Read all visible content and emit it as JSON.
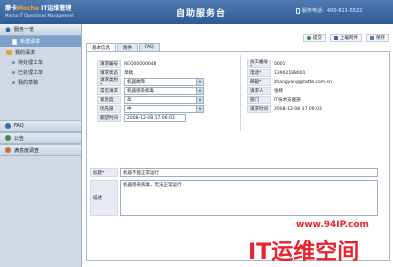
{
  "header": {
    "brand": "摩卡",
    "brand_accent": "Mocha",
    "brand_product": "IT运维管理",
    "brand_subtitle": "Mocha IT Operations Management",
    "center_title": "自助服务台",
    "hotline": "服务电话：400-611-5522"
  },
  "sidebar": {
    "head_label": "服务一览",
    "active_item": "新建请求",
    "my_requests": "我的请求",
    "sub_items": [
      "待处理工单",
      "已处理工单",
      "我的草稿"
    ],
    "sections": [
      {
        "label": "FAQ",
        "color": "#3d6aa2"
      },
      {
        "label": "公告",
        "color": "#3b8f3b"
      },
      {
        "label": "满意度调查",
        "color": "#c8722a"
      }
    ]
  },
  "toolbar": {
    "submit": "提交",
    "upload": "上载附件",
    "save": "保存"
  },
  "tabs": [
    "基本信息",
    "附件",
    "FAQ"
  ],
  "form": {
    "request_no_label": "请求编号",
    "request_no": "REQ00000048",
    "status_label": "请求状态",
    "status": "草稿",
    "category_label": "请求类别*",
    "category": "机器故障",
    "common_label": "常见请求",
    "common": "机器感染病毒",
    "urgency_label": "紧急度",
    "urgency": "高",
    "priority_label": "优先级",
    "priority": "中",
    "due_label": "期望时间",
    "due": "2008-12-08 17:06:03",
    "emp_no_label": "员工编号*",
    "emp_no": "0001",
    "phone_label": "电话*",
    "phone": "13902188001",
    "email_label": "邮箱*",
    "email": "zhangyang@tatte.com.cn",
    "requester_label": "请求人",
    "requester": "张杨",
    "dept_label": "部门",
    "dept": "IT技术支援部",
    "req_time_label": "请求时间",
    "req_time": "2008-12-08 17:06:03",
    "title_label": "标题*",
    "title": "机器不能正常运行",
    "desc_label": "描述",
    "desc": "机器感染病毒，无法正常运行"
  },
  "watermark": {
    "url": "www.94IP.com",
    "name": "IT运维空间"
  }
}
